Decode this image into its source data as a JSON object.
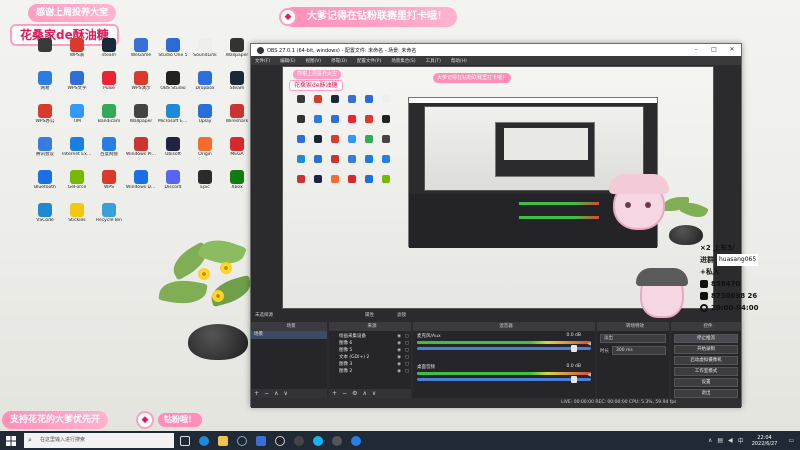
{
  "overlay": {
    "banner_top": "感谢上周投养大宝",
    "streamer_name": "花桑家de酥油糖",
    "banner_right": "大爹记得在钻粉联赛里打卡哦！",
    "banner_bottom": "支持花花的大爹优先开",
    "banner_bottom_badge": "钻粉哦！",
    "stats": {
      "queue": "×2 上车3/",
      "progress": "进群",
      "user_id": "huasang065",
      "plus": "+私人",
      "fans": "858470",
      "fan_id": "8750698 26",
      "time": "20:00-04:00"
    }
  },
  "desktop_icons": [
    {
      "label": "",
      "color": "#3a3a3a"
    },
    {
      "label": "WPS表",
      "color": "#d83b2b"
    },
    {
      "label": "steam",
      "color": "#1b2838"
    },
    {
      "label": "WeGame",
      "color": "#3a6fd8"
    },
    {
      "label": "Studio One 5",
      "color": "#2b6bd6"
    },
    {
      "label": "SoundLink",
      "color": "#eeeeee"
    },
    {
      "label": "Wallpaper",
      "color": "#333333"
    },
    {
      "label": "网易",
      "color": "#2a7de1"
    },
    {
      "label": "WPS文字",
      "color": "#2f6fd6"
    },
    {
      "label": "Pulse",
      "color": "#e23"
    },
    {
      "label": "WPS演示",
      "color": "#d83b2b"
    },
    {
      "label": "OBS Studio",
      "color": "#222222"
    },
    {
      "label": "Dropbox",
      "color": "#2d6fdd"
    },
    {
      "label": "Steam",
      "color": "#1b2838"
    },
    {
      "label": "WPS办公",
      "color": "#d83b2b"
    },
    {
      "label": "TIM",
      "color": "#3399ff"
    },
    {
      "label": "Bandicam",
      "color": "#33aa55"
    },
    {
      "label": "Wallpaper",
      "color": "#444"
    },
    {
      "label": "Microsoft Edge",
      "color": "#1e8bd6"
    },
    {
      "label": "Uplay",
      "color": "#2a6fd6"
    },
    {
      "label": "Wireshark",
      "color": "#c33"
    },
    {
      "label": "腾讯会议",
      "color": "#3a7be0"
    },
    {
      "label": "Internet Explorer",
      "color": "#1b7fe0"
    },
    {
      "label": "百度网盘",
      "color": "#2a7de1"
    },
    {
      "label": "Windows Player",
      "color": "#c33"
    },
    {
      "label": "Ubisoft",
      "color": "#224"
    },
    {
      "label": "Origin",
      "color": "#f56c2d"
    },
    {
      "label": "MEGA",
      "color": "#d9272e"
    },
    {
      "label": "Bluetooth",
      "color": "#1b6fe0"
    },
    {
      "label": "GeForce",
      "color": "#76b900"
    },
    {
      "label": "WPS",
      "color": "#d83b2b"
    },
    {
      "label": "Windows Defender",
      "color": "#1b6fe0"
    },
    {
      "label": "Discord",
      "color": "#5865f2"
    },
    {
      "label": "Epic",
      "color": "#2b2b2b"
    },
    {
      "label": "Xbox",
      "color": "#107c10"
    },
    {
      "label": "VSCode",
      "color": "#1f8ad2"
    },
    {
      "label": "Stickies",
      "color": "#f2c811"
    },
    {
      "label": "Recycle Bin",
      "color": "#3aa0d8"
    }
  ],
  "obs": {
    "title": "OBS 27.0.1 (64-bit, windows) - 配置文件: 未命名 - 场景: 未命名",
    "menu": [
      "文件(F)",
      "编辑(E)",
      "视图(V)",
      "停靠(D)",
      "配置文件(P)",
      "场景集合(S)",
      "工具(T)",
      "帮助(H)"
    ],
    "dock_preview_label": "未选择源",
    "dock_preview_props": "属性",
    "dock_preview_filters": "滤镜",
    "scenes_title": "场景",
    "scenes": [
      "场景"
    ],
    "sources_title": "来源",
    "sources": [
      "绘画采集设备",
      "图像 6",
      "图像 5",
      "文本 (GDI+) 2",
      "图像 3",
      "图像 2"
    ],
    "mixer_title": "混音器",
    "mixer": [
      {
        "name": "麦克风/Aux",
        "db": "0.0 dB"
      },
      {
        "name": "桌面音频",
        "db": "0.0 dB"
      }
    ],
    "transitions_title": "转场特效",
    "transition_type": "淡出",
    "transition_duration_label": "时长",
    "transition_duration": "300 ms",
    "controls_title": "控件",
    "controls": [
      "停止推流",
      "开始录制",
      "启动虚拟摄像机",
      "工作室模式",
      "设置",
      "退出"
    ],
    "statusbar": "LIVE: 00:00:00    REC: 00:00:00    CPU: 5.3%, 59.94 fps"
  },
  "taskbar": {
    "search_placeholder": "在这里输入进行搜索",
    "time": "22:04",
    "date": "2022/6/27"
  }
}
